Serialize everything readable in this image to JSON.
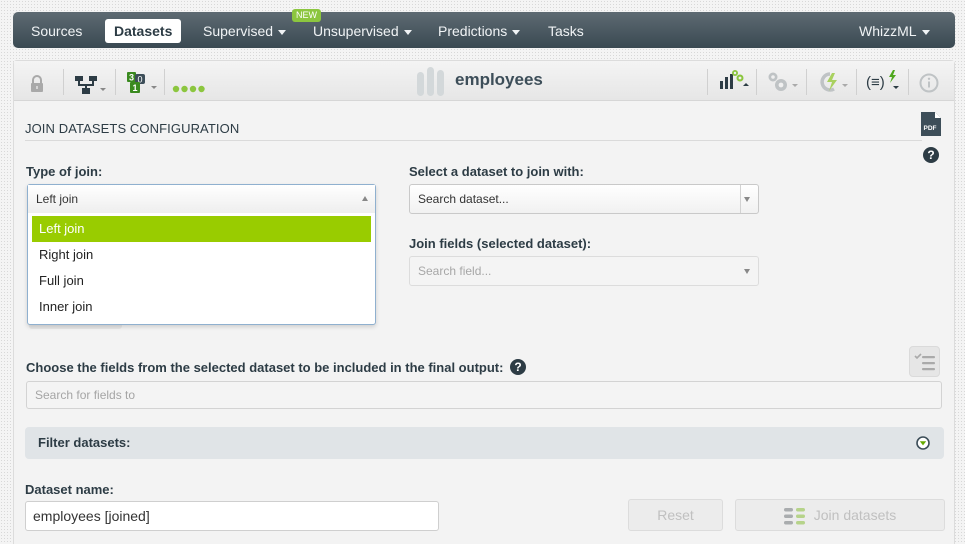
{
  "nav": {
    "items": [
      {
        "label": "Sources",
        "active": false
      },
      {
        "label": "Datasets",
        "active": true
      },
      {
        "label": "Supervised",
        "active": false
      },
      {
        "label": "Unsupervised",
        "active": false
      },
      {
        "label": "Predictions",
        "active": false
      },
      {
        "label": "Tasks",
        "active": false
      },
      {
        "label": "WhizzML",
        "active": false
      }
    ],
    "new_badge": "NEW"
  },
  "toolbar": {
    "title": "employees",
    "icons": [
      "lock-icon",
      "tree-icon",
      "numbers-icon",
      "status-dots-icon",
      "dataset-bars-icon",
      "chart-gears-icon",
      "gears-icon",
      "flash-cycle-icon",
      "whizzml-script-icon",
      "info-icon"
    ]
  },
  "config": {
    "title": "JOIN DATASETS CONFIGURATION",
    "pdf_label": "PDF",
    "type_of_join_label": "Type of join:",
    "type_of_join_value": "Left join",
    "join_options": [
      "Left join",
      "Right join",
      "Full join",
      "Inner join"
    ],
    "selected_option_index": 0,
    "select_dataset_label": "Select a dataset to join with:",
    "select_dataset_placeholder": "Search dataset...",
    "join_fields_label": "Join fields (selected dataset):",
    "join_fields_placeholder": "Search field...",
    "choose_fields_label": "Choose the fields from the selected dataset to be included in the final output:",
    "choose_fields_placeholder": "Search for fields to",
    "filter_label": "Filter datasets:",
    "dataset_name_label": "Dataset name:",
    "dataset_name_value": "employees [joined]",
    "reset_label": "Reset",
    "join_label": "Join datasets",
    "help_glyph": "?"
  },
  "colors": {
    "accent": "#99cc00",
    "nav_bg": "#3a4952",
    "text_dark": "#2d3c45"
  }
}
